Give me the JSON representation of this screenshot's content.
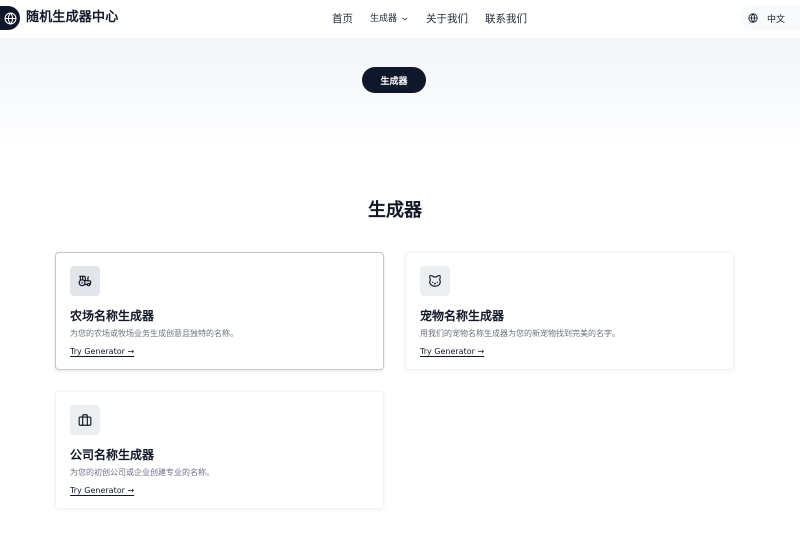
{
  "header": {
    "brand": "随机生成器中心",
    "logo_icon": "globe-icon",
    "nav": [
      {
        "label": "首页"
      },
      {
        "label": "生成器",
        "has_dropdown": true,
        "dropdown_icon": "chevron-down-icon"
      },
      {
        "label": "关于我们"
      },
      {
        "label": "联系我们"
      }
    ],
    "language": {
      "icon": "globe-icon",
      "label": "中文"
    }
  },
  "hero": {
    "pill_label": "生成器"
  },
  "section": {
    "title": "生成器",
    "cards": [
      {
        "icon": "tractor-icon",
        "title": "农场名称生成器",
        "description": "为您的农场或牧场业务生成创意且独特的名称。",
        "link": "Try Generator →",
        "state": "hovered"
      },
      {
        "icon": "cat-icon",
        "title": "宠物名称生成器",
        "description": "用我们的宠物名称生成器为您的新宠物找到完美的名字。",
        "link": "Try Generator →"
      },
      {
        "icon": "briefcase-icon",
        "title": "公司名称生成器",
        "description": "为您的初创公司或企业创建专业的名称。",
        "link": "Try Generator →"
      }
    ]
  },
  "colors": {
    "primary": "#0f172a",
    "text": "#111827",
    "muted": "#6b7280",
    "icon_bg": "#eceff2"
  }
}
